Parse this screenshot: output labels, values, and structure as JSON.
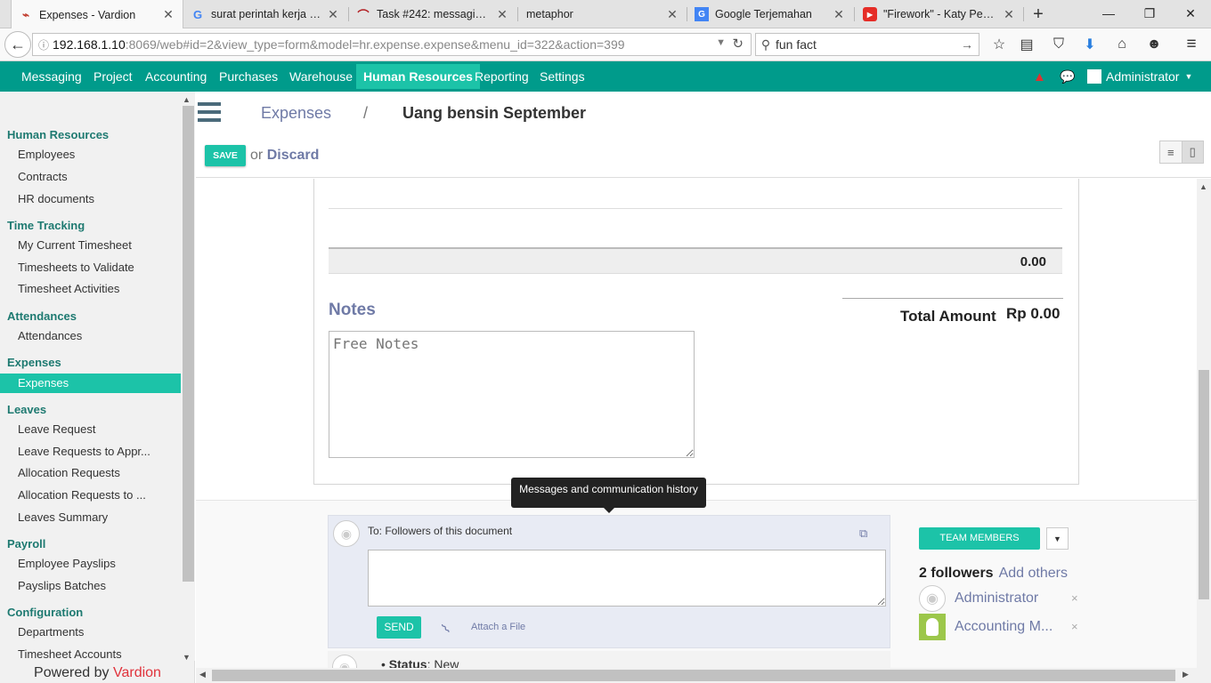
{
  "browser": {
    "tabs": [
      {
        "title": "Expenses - Vardion",
        "icon": "vardion-icon",
        "color": "#c0392b"
      },
      {
        "title": "surat perintah kerja - ...",
        "icon": "google-icon",
        "color": "#4285f4"
      },
      {
        "title": "Task #242: messaging ...",
        "icon": "redmine-icon",
        "color": "#b32024"
      },
      {
        "title": "metaphor",
        "icon": "",
        "color": ""
      },
      {
        "title": "Google Terjemahan",
        "icon": "translate-icon",
        "color": "#4285f4"
      },
      {
        "title": "\"Firework\" - Katy Perr...",
        "icon": "youtube-icon",
        "color": "#e52d27"
      }
    ],
    "url_host": "192.168.1.10",
    "url_rest": ":8069/web#id=2&view_type=form&model=hr.expense.expense&menu_id=322&action=399",
    "search_value": "fun fact"
  },
  "menu": {
    "items": [
      "Messaging",
      "Project",
      "Accounting",
      "Purchases",
      "Warehouse",
      "Human Resources",
      "Reporting",
      "Settings"
    ],
    "active": "Human Resources",
    "user": "Administrator"
  },
  "sidebar": {
    "sections": [
      {
        "title": "Human Resources",
        "items": [
          "Employees",
          "Contracts",
          "HR documents"
        ]
      },
      {
        "title": "Time Tracking",
        "items": [
          "My Current Timesheet",
          "Timesheets to Validate",
          "Timesheet Activities"
        ]
      },
      {
        "title": "Attendances",
        "items": [
          "Attendances"
        ]
      },
      {
        "title": "Expenses",
        "items": [
          "Expenses"
        ]
      },
      {
        "title": "Leaves",
        "items": [
          "Leave Request",
          "Leave Requests to Appr...",
          "Allocation Requests",
          "Allocation Requests to ...",
          "Leaves Summary"
        ]
      },
      {
        "title": "Payroll",
        "items": [
          "Employee Payslips",
          "Payslips Batches"
        ]
      },
      {
        "title": "Configuration",
        "items": [
          "Departments",
          "Timesheet Accounts"
        ]
      }
    ],
    "active_item": "Expenses",
    "powered_prefix": "Powered by",
    "powered_brand": "Vardion"
  },
  "control": {
    "breadcrumb_parent": "Expenses",
    "breadcrumb_sep": "/",
    "breadcrumb_current": "Uang bensin September",
    "save_label": "SAVE",
    "or_label": "or",
    "discard_label": "Discard"
  },
  "form": {
    "line_total": "0.00",
    "notes_title": "Notes",
    "notes_placeholder": "Free Notes",
    "total_label": "Total Amount",
    "total_value": "Rp 0.00"
  },
  "chatter": {
    "tooltip": "Messages and communication history",
    "to_label": "To: Followers of this document",
    "send_label": "SEND",
    "attach_label": "Attach a File",
    "status_label": "Status",
    "status_value": "New",
    "team_label": "TEAM MEMBERS",
    "followers_count": "2 followers",
    "add_others": "Add others",
    "followers": [
      "Administrator",
      "Accounting M..."
    ]
  }
}
